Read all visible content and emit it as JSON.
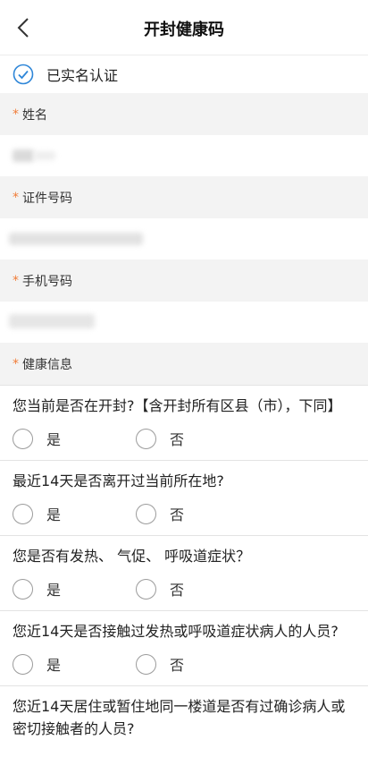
{
  "header": {
    "title": "开封健康码",
    "back_icon": "chevron-left-icon"
  },
  "verified": {
    "text": "已实名认证",
    "icon": "check-circle-icon",
    "color": "#2e86d8"
  },
  "fields": {
    "name_label": "姓名",
    "id_label": "证件号码",
    "phone_label": "手机号码",
    "health_label": "健康信息",
    "required_mark": "*"
  },
  "questions": [
    {
      "text": "您当前是否在开封?【含开封所有区县（市），下同】",
      "yes": "是",
      "no": "否"
    },
    {
      "text": "最近14天是否离开过当前所在地?",
      "yes": "是",
      "no": "否"
    },
    {
      "text": "您是否有发热、 气促、 呼吸道症状？",
      "yes": "是",
      "no": "否"
    },
    {
      "text": "您近14天是否接触过发热或呼吸道症状病人的人员?",
      "yes": "是",
      "no": "否"
    },
    {
      "text": "您近14天居住或暂住地同一楼道是否有过确诊病人或密切接触者的人员?"
    }
  ],
  "colors": {
    "accent": "#2e86d8",
    "required": "#f07c37",
    "section_bg": "#f3f3f3"
  }
}
